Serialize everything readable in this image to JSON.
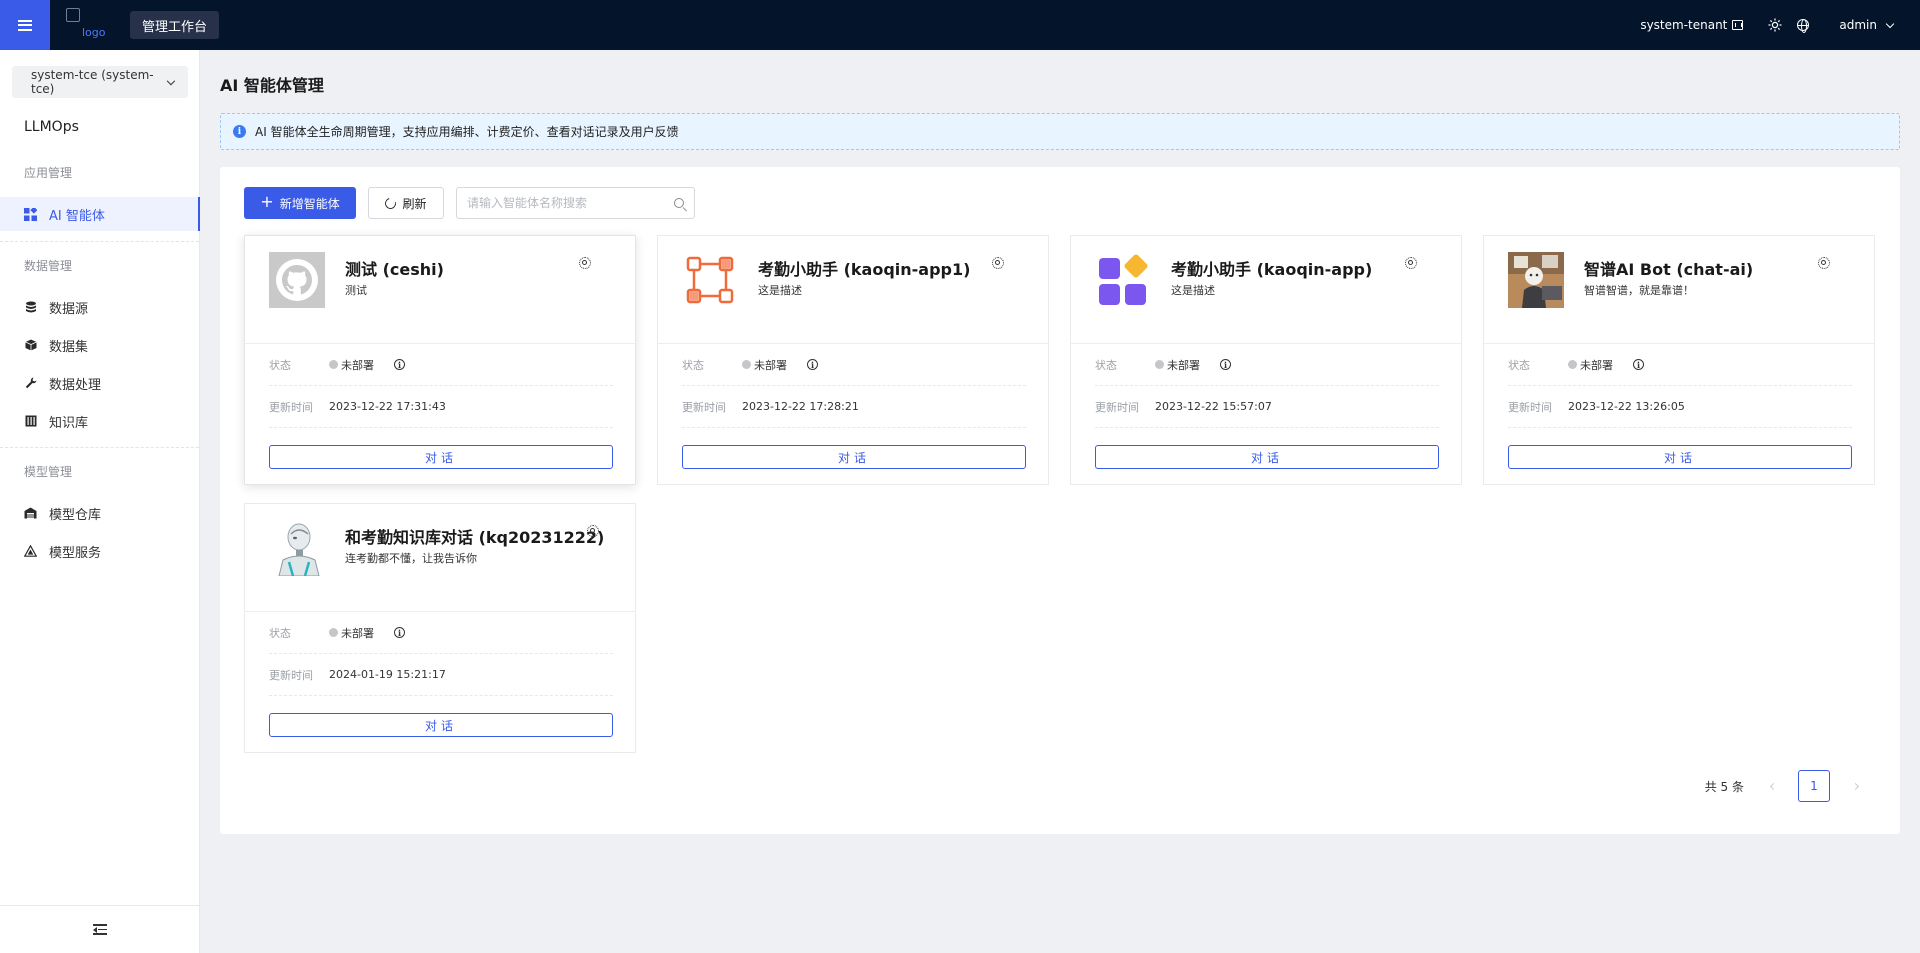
{
  "topbar": {
    "logo_alt": "logo",
    "workspace": "管理工作台",
    "tenant": "system-tenant",
    "user": "admin"
  },
  "sidebar": {
    "tenant_select": "system-tce (system-tce)",
    "app_name": "LLMOps",
    "groups": {
      "app": "应用管理",
      "data": "数据管理",
      "model": "模型管理"
    },
    "items": {
      "agent": "AI 智能体",
      "datasource": "数据源",
      "dataset": "数据集",
      "processing": "数据处理",
      "knowledge": "知识库",
      "model_repo": "模型仓库",
      "model_service": "模型服务"
    }
  },
  "main": {
    "title": "AI 智能体管理",
    "info": "AI 智能体全生命周期管理，支持应用编排、计费定价、查看对话记录及用户反馈",
    "add_button": "新增智能体",
    "refresh_button": "刷新",
    "search_placeholder": "请输入智能体名称搜索",
    "status_label": "状态",
    "updated_label": "更新时间",
    "chat_button": "对话",
    "total_text": "共 5 条",
    "current_page": "1"
  },
  "cards": [
    {
      "name": "测试 (ceshi)",
      "desc": "测试",
      "status": "未部署",
      "updated": "2023-12-22 17:31:43",
      "icon": "github-avatar-icon"
    },
    {
      "name": "考勤小助手 (kaoqin-app1)",
      "desc": "这是描述",
      "status": "未部署",
      "updated": "2023-12-22 17:28:21",
      "icon": "nodes-icon"
    },
    {
      "name": "考勤小助手 (kaoqin-app)",
      "desc": "这是描述",
      "status": "未部署",
      "updated": "2023-12-22 15:57:07",
      "icon": "apps-grid-icon"
    },
    {
      "name": "智谱AI Bot (chat-ai)",
      "desc": "智谱智谱，就是靠谱！",
      "status": "未部署",
      "updated": "2023-12-22 13:26:05",
      "icon": "bot-photo-icon"
    },
    {
      "name": "和考勤知识库对话 (kq20231222)",
      "desc": "连考勤都不懂，让我告诉你",
      "status": "未部署",
      "updated": "2024-01-19 15:21:17",
      "icon": "robot-photo-icon"
    }
  ],
  "colors": {
    "accent": "#3a5be8",
    "topbar": "#04142b",
    "status_undeployed": "#c4c6ca"
  }
}
